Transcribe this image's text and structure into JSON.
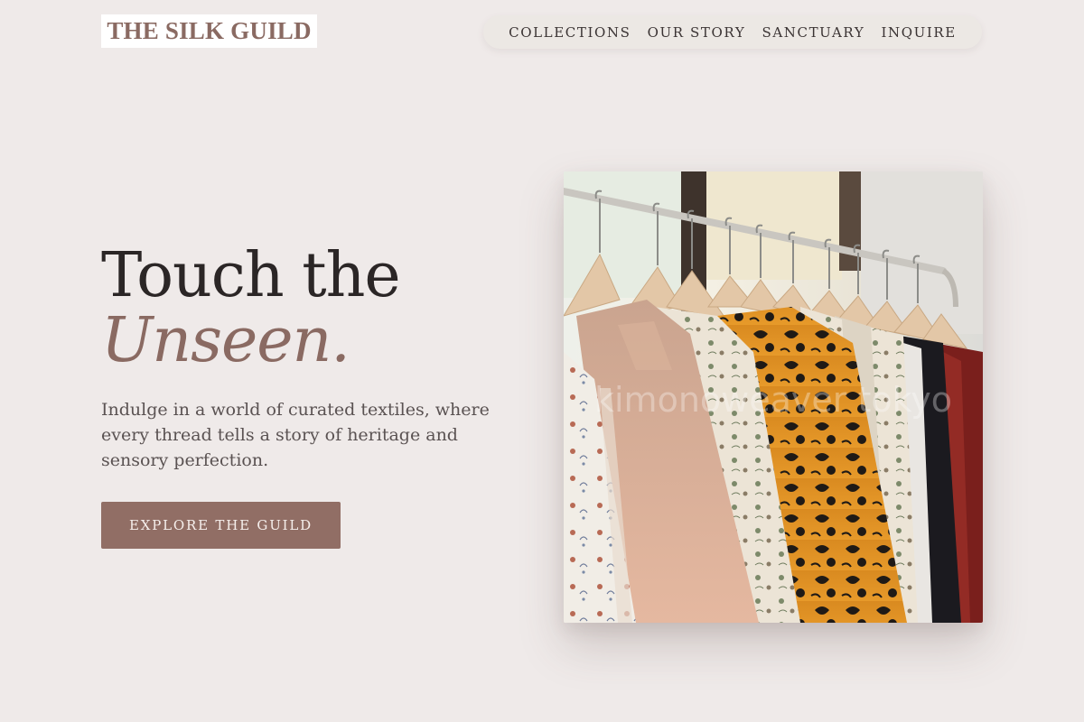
{
  "header": {
    "logo": "THE SILK GUILD",
    "nav": [
      {
        "label": "COLLECTIONS"
      },
      {
        "label": "OUR STORY"
      },
      {
        "label": "SANCTUARY"
      },
      {
        "label": "INQUIRE"
      }
    ]
  },
  "hero": {
    "headline_line1": "Touch the",
    "headline_line2": "Unseen.",
    "lede": "Indulge in a world of curated textiles, where every thread tells a story of heritage and sensory perfection.",
    "cta_label": "EXPLORE THE GUILD",
    "image_watermark": "kimonoweaver tokyo"
  },
  "colors": {
    "background": "#efeae9",
    "accent": "#8a6a62",
    "button": "#916e65",
    "text": "#2b2626"
  }
}
